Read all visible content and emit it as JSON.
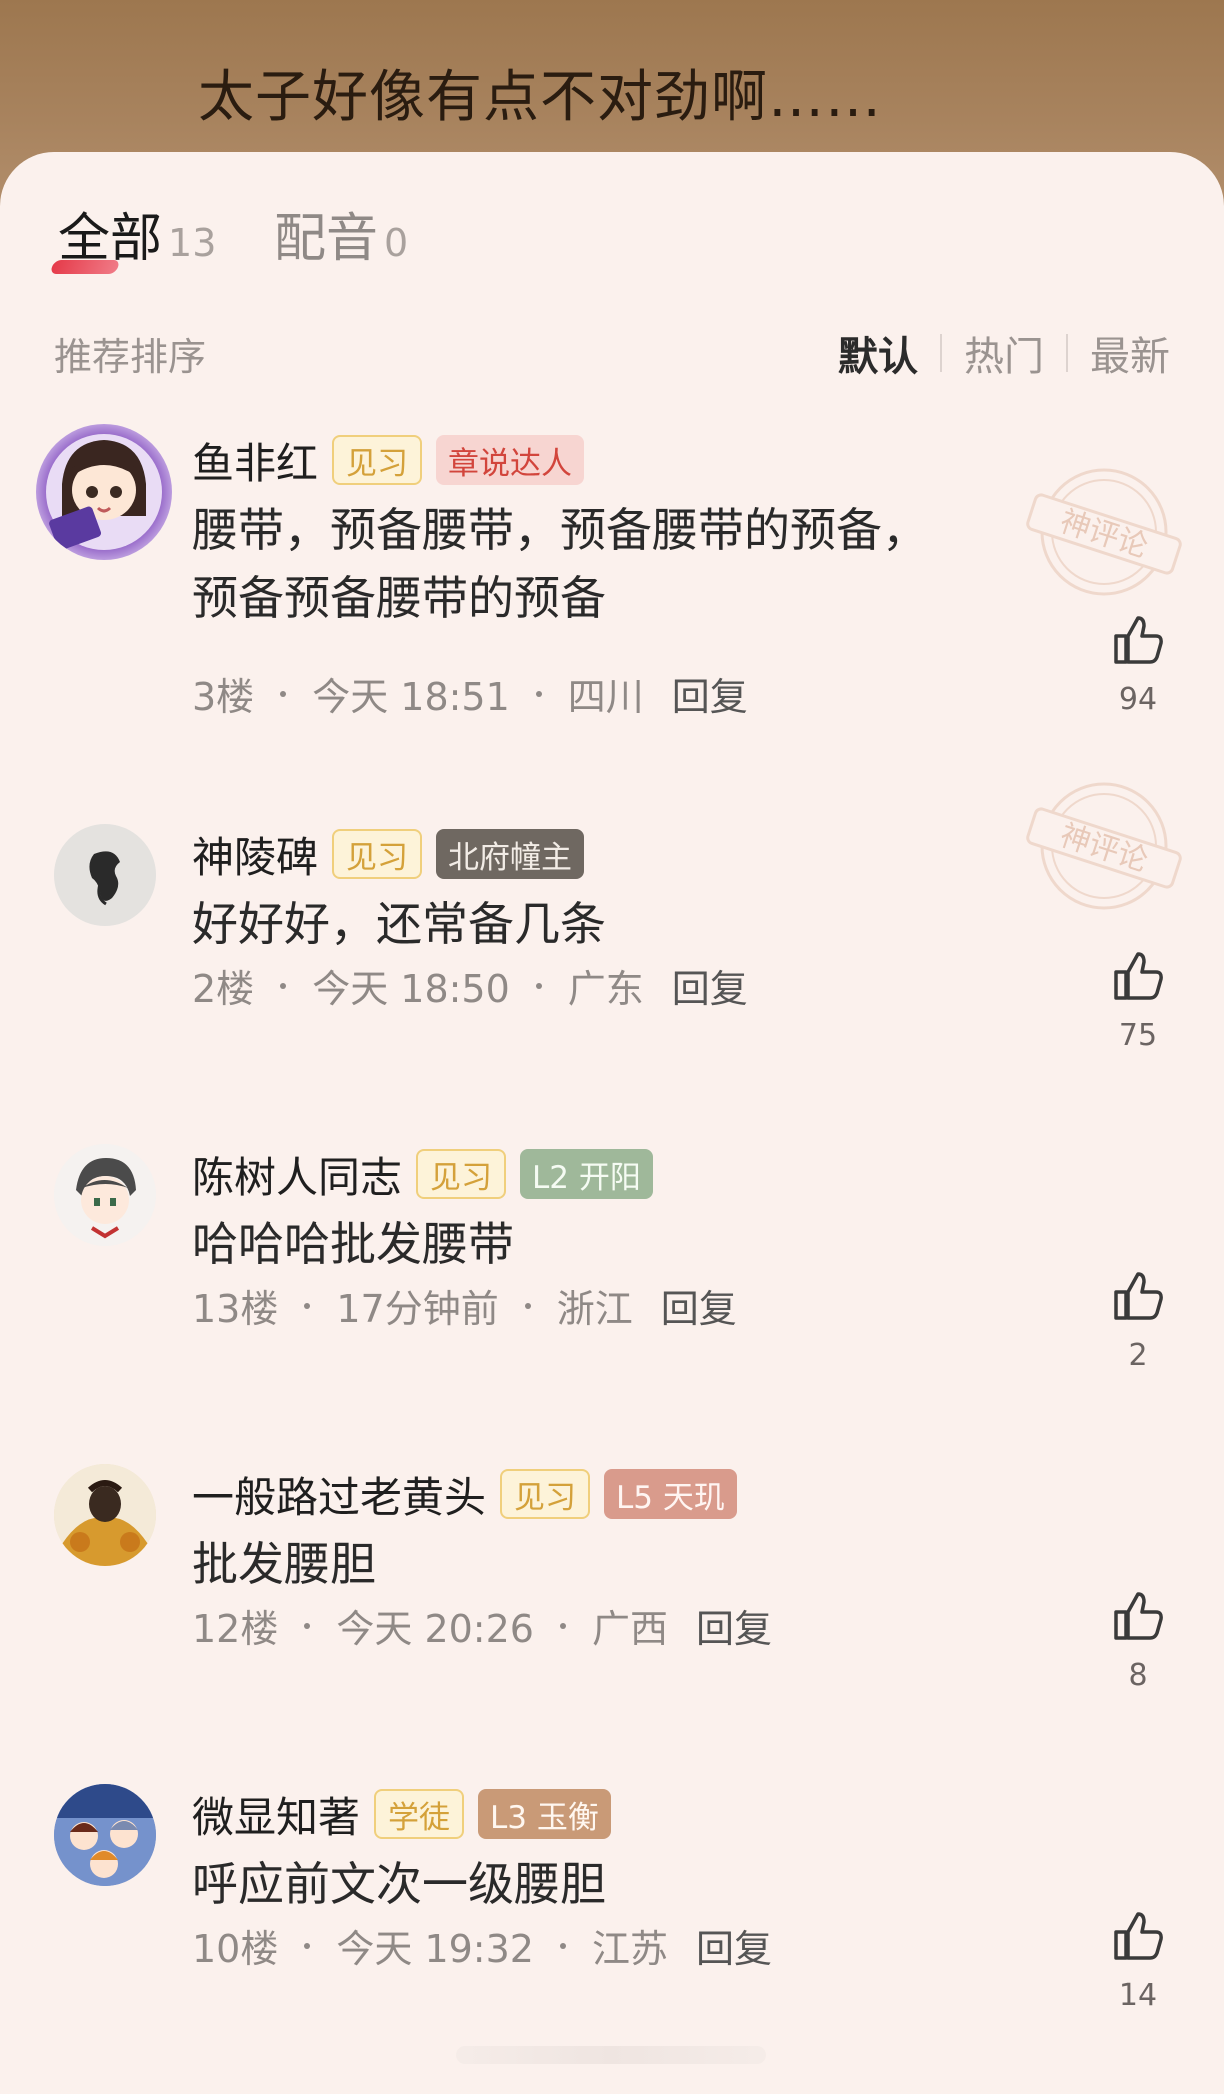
{
  "chapter": {
    "text": "太子好像有点不对劲啊……"
  },
  "tabs": [
    {
      "label": "全部",
      "count": "13"
    },
    {
      "label": "配音",
      "count": "0"
    }
  ],
  "sort": {
    "title": "推荐排序",
    "options": [
      "默认",
      "热门",
      "最新"
    ],
    "active": "默认"
  },
  "seal_label": "神评论",
  "comments": [
    {
      "name": "鱼非红",
      "badges": [
        "见习",
        "章说达人"
      ],
      "text": "腰带，预备腰带，预备腰带的预备，预备预备腰带的预备",
      "floor": "3楼",
      "time": "今天 18:51",
      "region": "四川",
      "reply": "回复",
      "likes": "94",
      "featured": true
    },
    {
      "name": "神陵碑",
      "badges": [
        "见习",
        "北府幢主"
      ],
      "text": "好好好，还常备几条",
      "floor": "2楼",
      "time": "今天 18:50",
      "region": "广东",
      "reply": "回复",
      "likes": "75",
      "featured": true
    },
    {
      "name": "陈树人同志",
      "badges": [
        "见习",
        "L2 开阳"
      ],
      "text": "哈哈哈批发腰带",
      "floor": "13楼",
      "time": "17分钟前",
      "region": "浙江",
      "reply": "回复",
      "likes": "2",
      "featured": false
    },
    {
      "name": "一般路过老黄头",
      "badges": [
        "见习",
        "L5 天玑"
      ],
      "text": "批发腰胆",
      "floor": "12楼",
      "time": "今天 20:26",
      "region": "广西",
      "reply": "回复",
      "likes": "8",
      "featured": false
    },
    {
      "name": "微显知著",
      "badges": [
        "学徒",
        "L3 玉衡"
      ],
      "text": "呼应前文次一级腰胆",
      "floor": "10楼",
      "time": "今天 19:32",
      "region": "江苏",
      "reply": "回复",
      "likes": "14",
      "featured": false
    }
  ]
}
